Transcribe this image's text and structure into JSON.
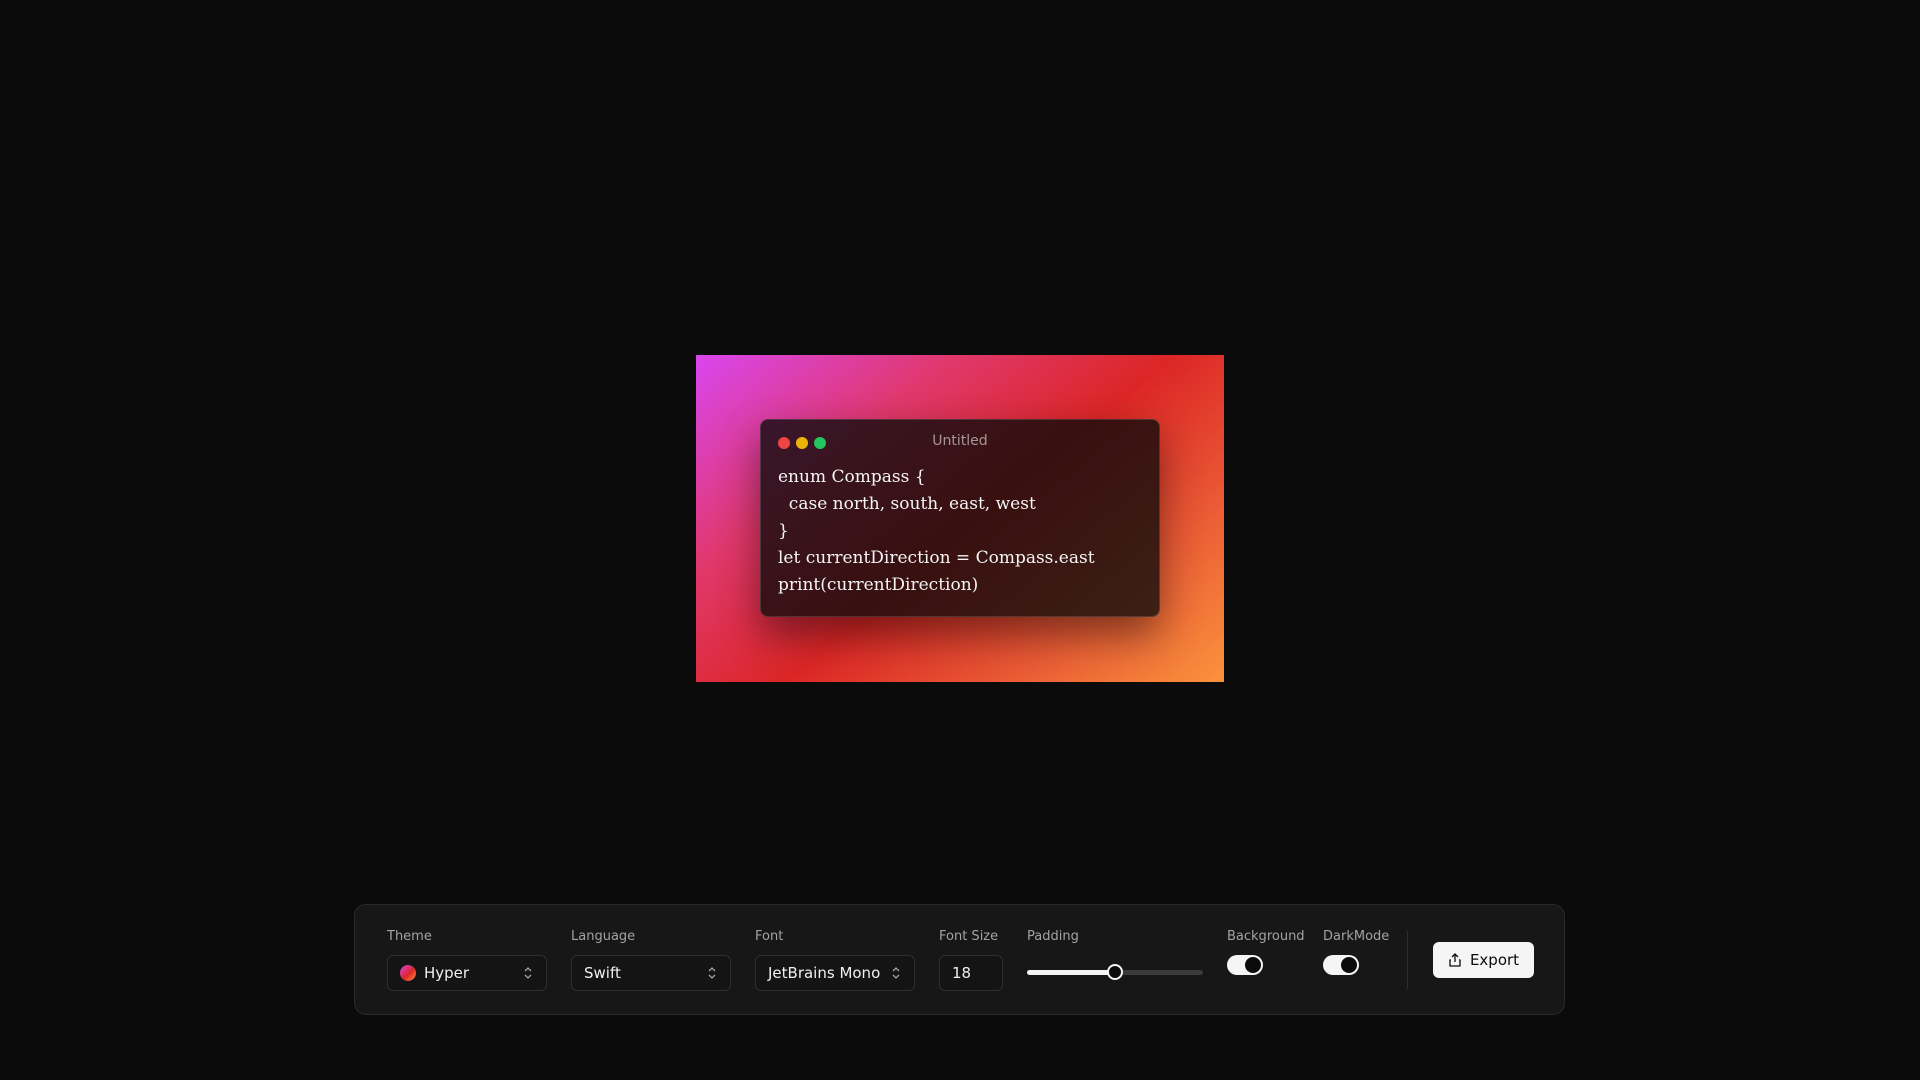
{
  "editor": {
    "window_title": "Untitled",
    "code_lines": [
      "enum Compass {",
      "  case north, south, east, west",
      "}",
      "let currentDirection = Compass.east",
      "print(currentDirection)"
    ],
    "background_gradient": [
      "#d946ef",
      "#dc2626",
      "#fb923c"
    ],
    "traffic_lights": [
      "#ef4444",
      "#eab308",
      "#22c55e"
    ]
  },
  "toolbar": {
    "theme": {
      "label": "Theme",
      "value": "Hyper",
      "icon": "theme-swatch-icon"
    },
    "language": {
      "label": "Language",
      "value": "Swift",
      "icon": "chevron-up-down-icon"
    },
    "font": {
      "label": "Font",
      "value": "JetBrains Mono",
      "icon": "chevron-up-down-icon"
    },
    "font_size": {
      "label": "Font Size",
      "value": "18"
    },
    "padding": {
      "label": "Padding",
      "level_fraction": 0.5
    },
    "background": {
      "label": "Background",
      "enabled": true
    },
    "dark_mode": {
      "label": "DarkMode",
      "enabled": true
    },
    "export": {
      "label": "Export",
      "icon": "share-icon"
    }
  }
}
